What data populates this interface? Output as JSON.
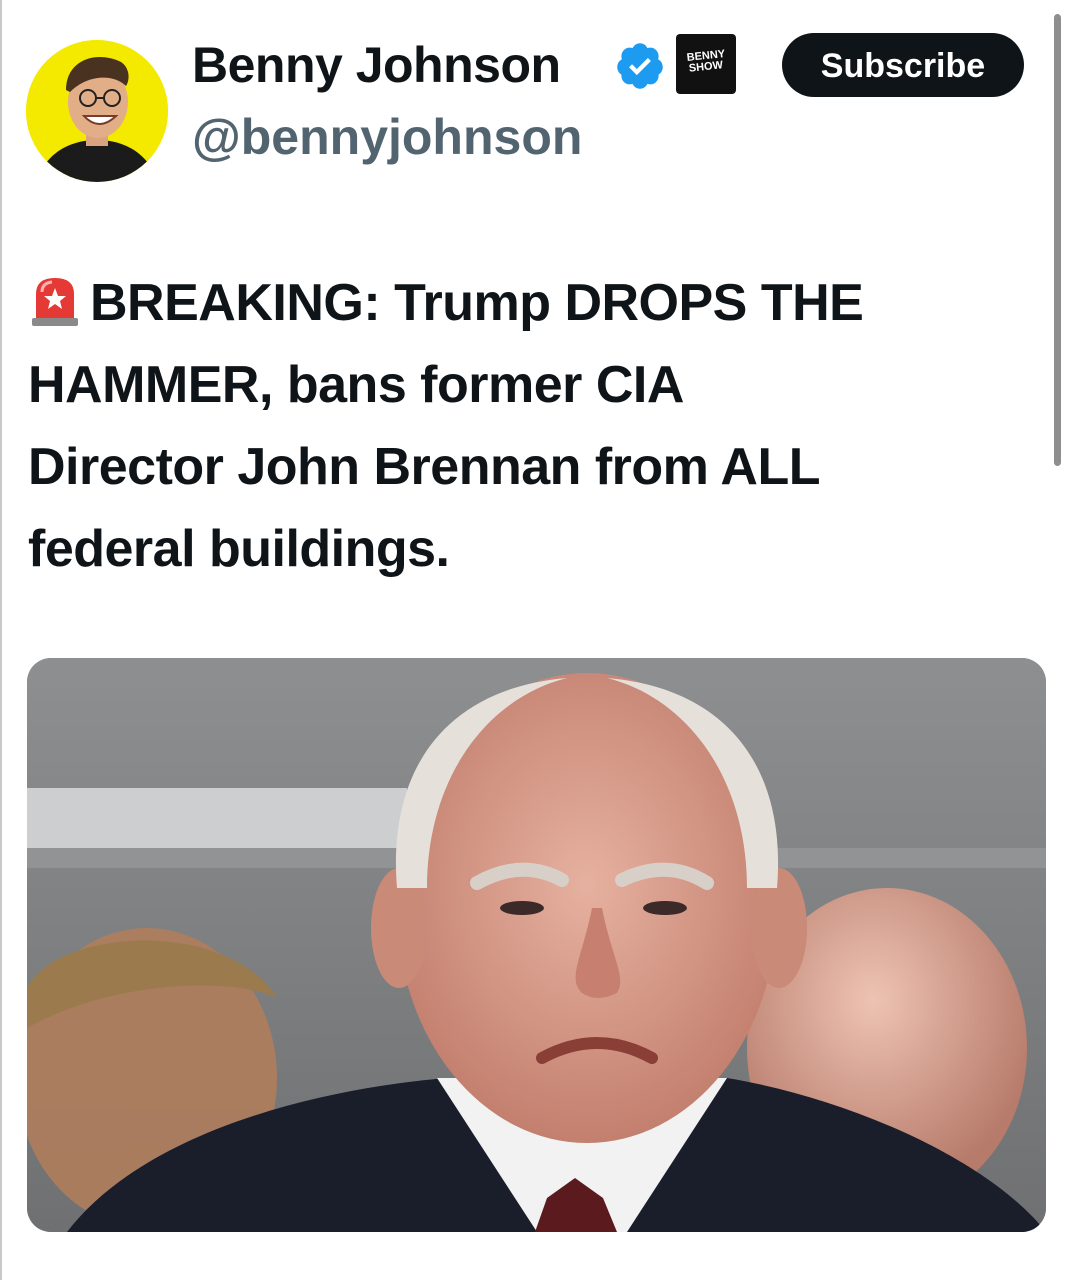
{
  "profile": {
    "display_name": "Benny Johnson",
    "handle": "@bennyjohnson",
    "verified_icon": "verified-badge-icon",
    "verified_color": "#1d9bf0",
    "show_badge": {
      "line1": "BENNY",
      "line2": "SHOW"
    },
    "avatar_background": "#f4ea00"
  },
  "actions": {
    "subscribe_label": "Subscribe"
  },
  "post": {
    "emoji_icon": "police-siren-icon",
    "lines": [
      "BREAKING: Trump DROPS THE",
      "HAMMER, bans former CIA",
      "Director John Brennan from ALL",
      "federal buildings."
    ]
  },
  "media": {
    "image_icon": "photo-man-frowning"
  }
}
